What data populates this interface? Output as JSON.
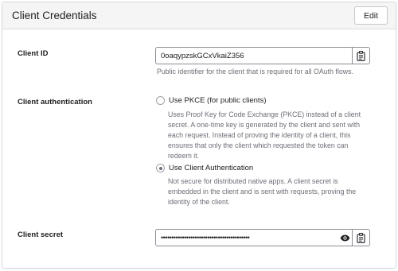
{
  "panel": {
    "title": "Client Credentials",
    "edit_label": "Edit"
  },
  "client_id": {
    "label": "Client ID",
    "value": "0oaqypzskGCxVkaiZ356",
    "help": "Public identifier for the client that is required for all OAuth flows.",
    "copy_icon": "clipboard-icon"
  },
  "client_auth": {
    "label": "Client authentication",
    "options": [
      {
        "label": "Use PKCE (for public clients)",
        "checked": false,
        "help": "Uses Proof Key for Code Exchange (PKCE) instead of a client secret. A one-time key is generated by the client and sent with each request. Instead of proving the identity of a client, this ensures that only the client which requested the token can redeem it."
      },
      {
        "label": "Use Client Authentication",
        "checked": true,
        "help": "Not secure for distributed native apps. A client secret is embedded in the client and is sent with requests, proving the identity of the client."
      }
    ]
  },
  "client_secret": {
    "label": "Client secret",
    "value": "••••••••••••••••••••••••••••••••••••••••••",
    "reveal_icon": "eye-icon",
    "copy_icon": "clipboard-icon"
  }
}
